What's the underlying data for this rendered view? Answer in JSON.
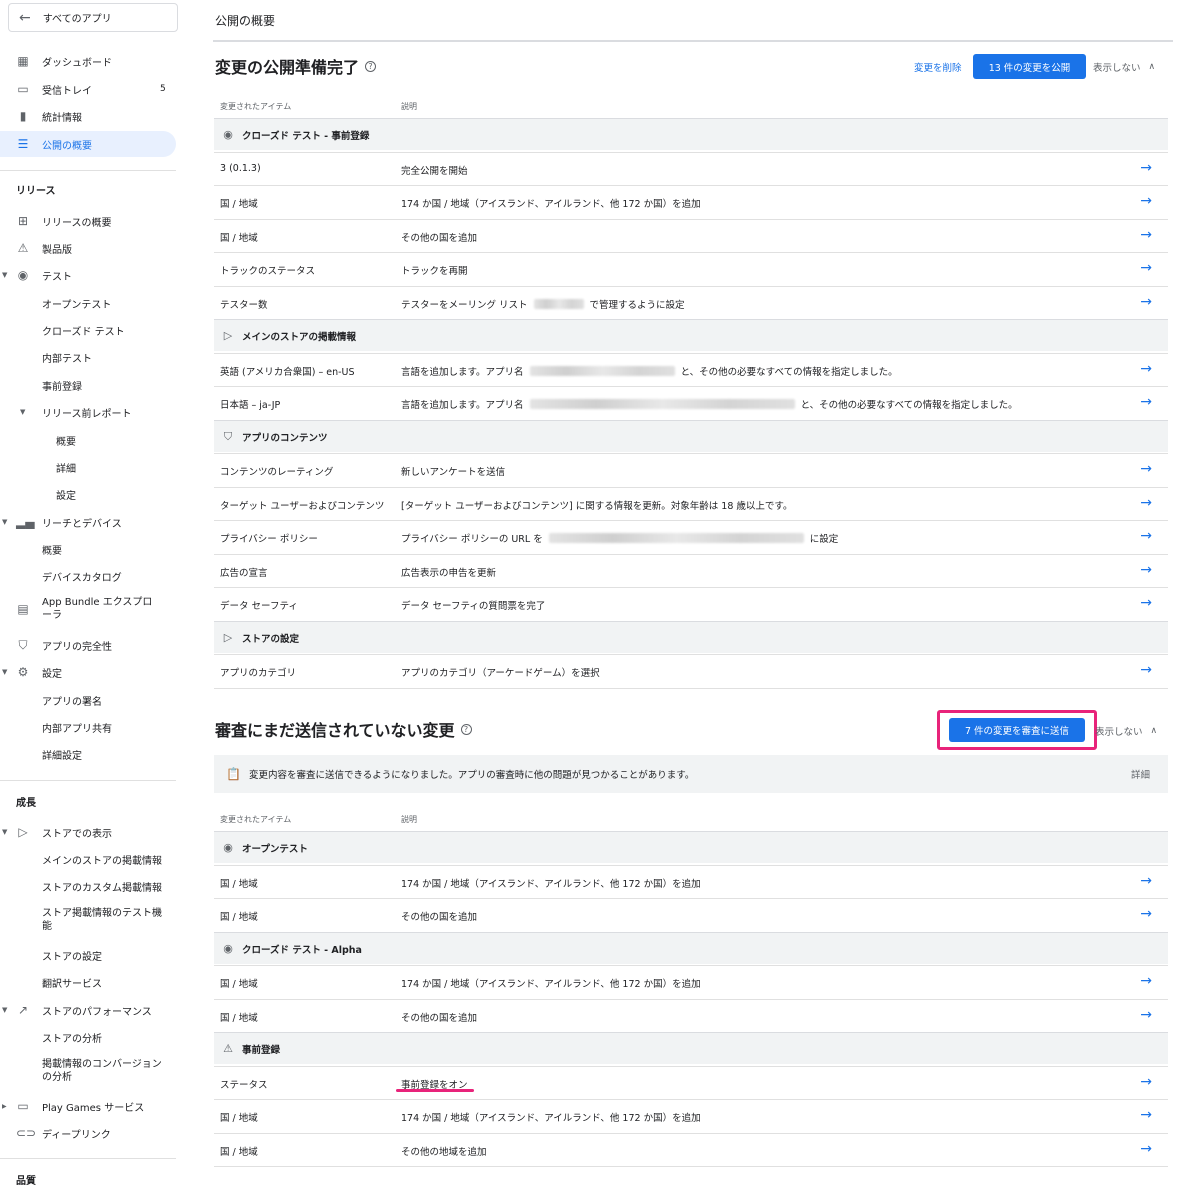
{
  "sidebar": {
    "back_label": "すべてのアプリ",
    "top_items": [
      {
        "label": "ダッシュボード",
        "icon": "dashboard-icon"
      },
      {
        "label": "受信トレイ",
        "icon": "inbox-icon",
        "badge": "5"
      },
      {
        "label": "統計情報",
        "icon": "stats-icon"
      },
      {
        "label": "公開の概要",
        "icon": "publishing-icon",
        "active": true
      }
    ],
    "release_heading": "リリース",
    "release_items": [
      "リリースの概要",
      "製品版",
      "テスト",
      "オープンテスト",
      "クローズド テスト",
      "内部テスト",
      "事前登録",
      "リリース前レポート",
      "概要",
      "詳細",
      "設定",
      "リーチとデバイス",
      "概要",
      "デバイスカタログ",
      "App Bundle エクスプローラ",
      "アプリの完全性",
      "設定",
      "アプリの署名",
      "内部アプリ共有",
      "詳細設定"
    ],
    "growth_heading": "成長",
    "growth_items": [
      "ストアでの表示",
      "メインのストアの掲載情報",
      "ストアのカスタム掲載情報",
      "ストア掲載情報のテスト機能",
      "ストアの設定",
      "翻訳サービス",
      "ストアのパフォーマンス",
      "ストアの分析",
      "掲載情報のコンバージョンの分析",
      "Play Games サービス",
      "ディープリンク"
    ],
    "quality_heading": "品質"
  },
  "main": {
    "page_title": "公開の概要",
    "section1": {
      "title": "変更の公開準備完了",
      "delete_label": "変更を削除",
      "publish_label": "13 件の変更を公開",
      "hide_label": "表示しない",
      "col_item": "変更されたアイテム",
      "col_desc": "説明",
      "groups": [
        {
          "title": "クローズド テスト - 事前登録",
          "rows": [
            {
              "item": "3 (0.1.3)",
              "desc": "完全公開を開始"
            },
            {
              "item": "国 / 地域",
              "desc": "174 か国 / 地域（アイスランド、アイルランド、他 172 か国）を追加"
            },
            {
              "item": "国 / 地域",
              "desc": "その他の国を追加"
            },
            {
              "item": "トラックのステータス",
              "desc": "トラックを再開"
            },
            {
              "item": "テスター数",
              "desc_a": "テスターをメーリング リスト",
              "desc_b": "で管理するように設定"
            }
          ]
        },
        {
          "title": "メインのストアの掲載情報",
          "rows": [
            {
              "item": "英語 (アメリカ合衆国) – en-US",
              "desc_a": "言語を追加します。アプリ名",
              "desc_b": "と、その他の必要なすべての情報を指定しました。"
            },
            {
              "item": "日本語 – ja-JP",
              "desc_a": "言語を追加します。アプリ名",
              "desc_b": "と、その他の必要なすべての情報を指定しました。"
            }
          ]
        },
        {
          "title": "アプリのコンテンツ",
          "rows": [
            {
              "item": "コンテンツのレーティング",
              "desc": "新しいアンケートを送信"
            },
            {
              "item": "ターゲット ユーザーおよびコンテンツ",
              "desc": "[ターゲット ユーザーおよびコンテンツ] に関する情報を更新。対象年齢は 18 歳以上です。"
            },
            {
              "item": "プライバシー ポリシー",
              "desc_a": "プライバシー ポリシーの URL を",
              "desc_b": "に設定"
            },
            {
              "item": "広告の宣言",
              "desc": "広告表示の申告を更新"
            },
            {
              "item": "データ セーフティ",
              "desc": "データ セーフティの質問票を完了"
            }
          ]
        },
        {
          "title": "ストアの設定",
          "rows": [
            {
              "item": "アプリのカテゴリ",
              "desc": "アプリのカテゴリ（アーケードゲーム）を選択"
            }
          ]
        }
      ]
    },
    "section2": {
      "title": "審査にまだ送信されていない変更",
      "send_label": "7 件の変更を審査に送信",
      "hide_label": "表示しない",
      "info_text": "変更内容を審査に送信できるようになりました。アプリの審査時に他の問題が見つかることがあります。",
      "info_details": "詳細",
      "col_item": "変更されたアイテム",
      "col_desc": "説明",
      "groups": [
        {
          "title": "オープンテスト",
          "rows": [
            {
              "item": "国 / 地域",
              "desc": "174 か国 / 地域（アイスランド、アイルランド、他 172 か国）を追加"
            },
            {
              "item": "国 / 地域",
              "desc": "その他の国を追加"
            }
          ]
        },
        {
          "title": "クローズド テスト - Alpha",
          "rows": [
            {
              "item": "国 / 地域",
              "desc": "174 か国 / 地域（アイスランド、アイルランド、他 172 か国）を追加"
            },
            {
              "item": "国 / 地域",
              "desc": "その他の国を追加"
            }
          ]
        },
        {
          "title": "事前登録",
          "rows": [
            {
              "item": "ステータス",
              "desc": "事前登録をオン"
            },
            {
              "item": "国 / 地域",
              "desc": "174 か国 / 地域（アイスランド、アイルランド、他 172 か国）を追加"
            },
            {
              "item": "国 / 地域",
              "desc": "その他の地域を追加"
            }
          ]
        }
      ]
    }
  },
  "colors": {
    "accent": "#1a73e8",
    "highlight": "#e8237a"
  }
}
